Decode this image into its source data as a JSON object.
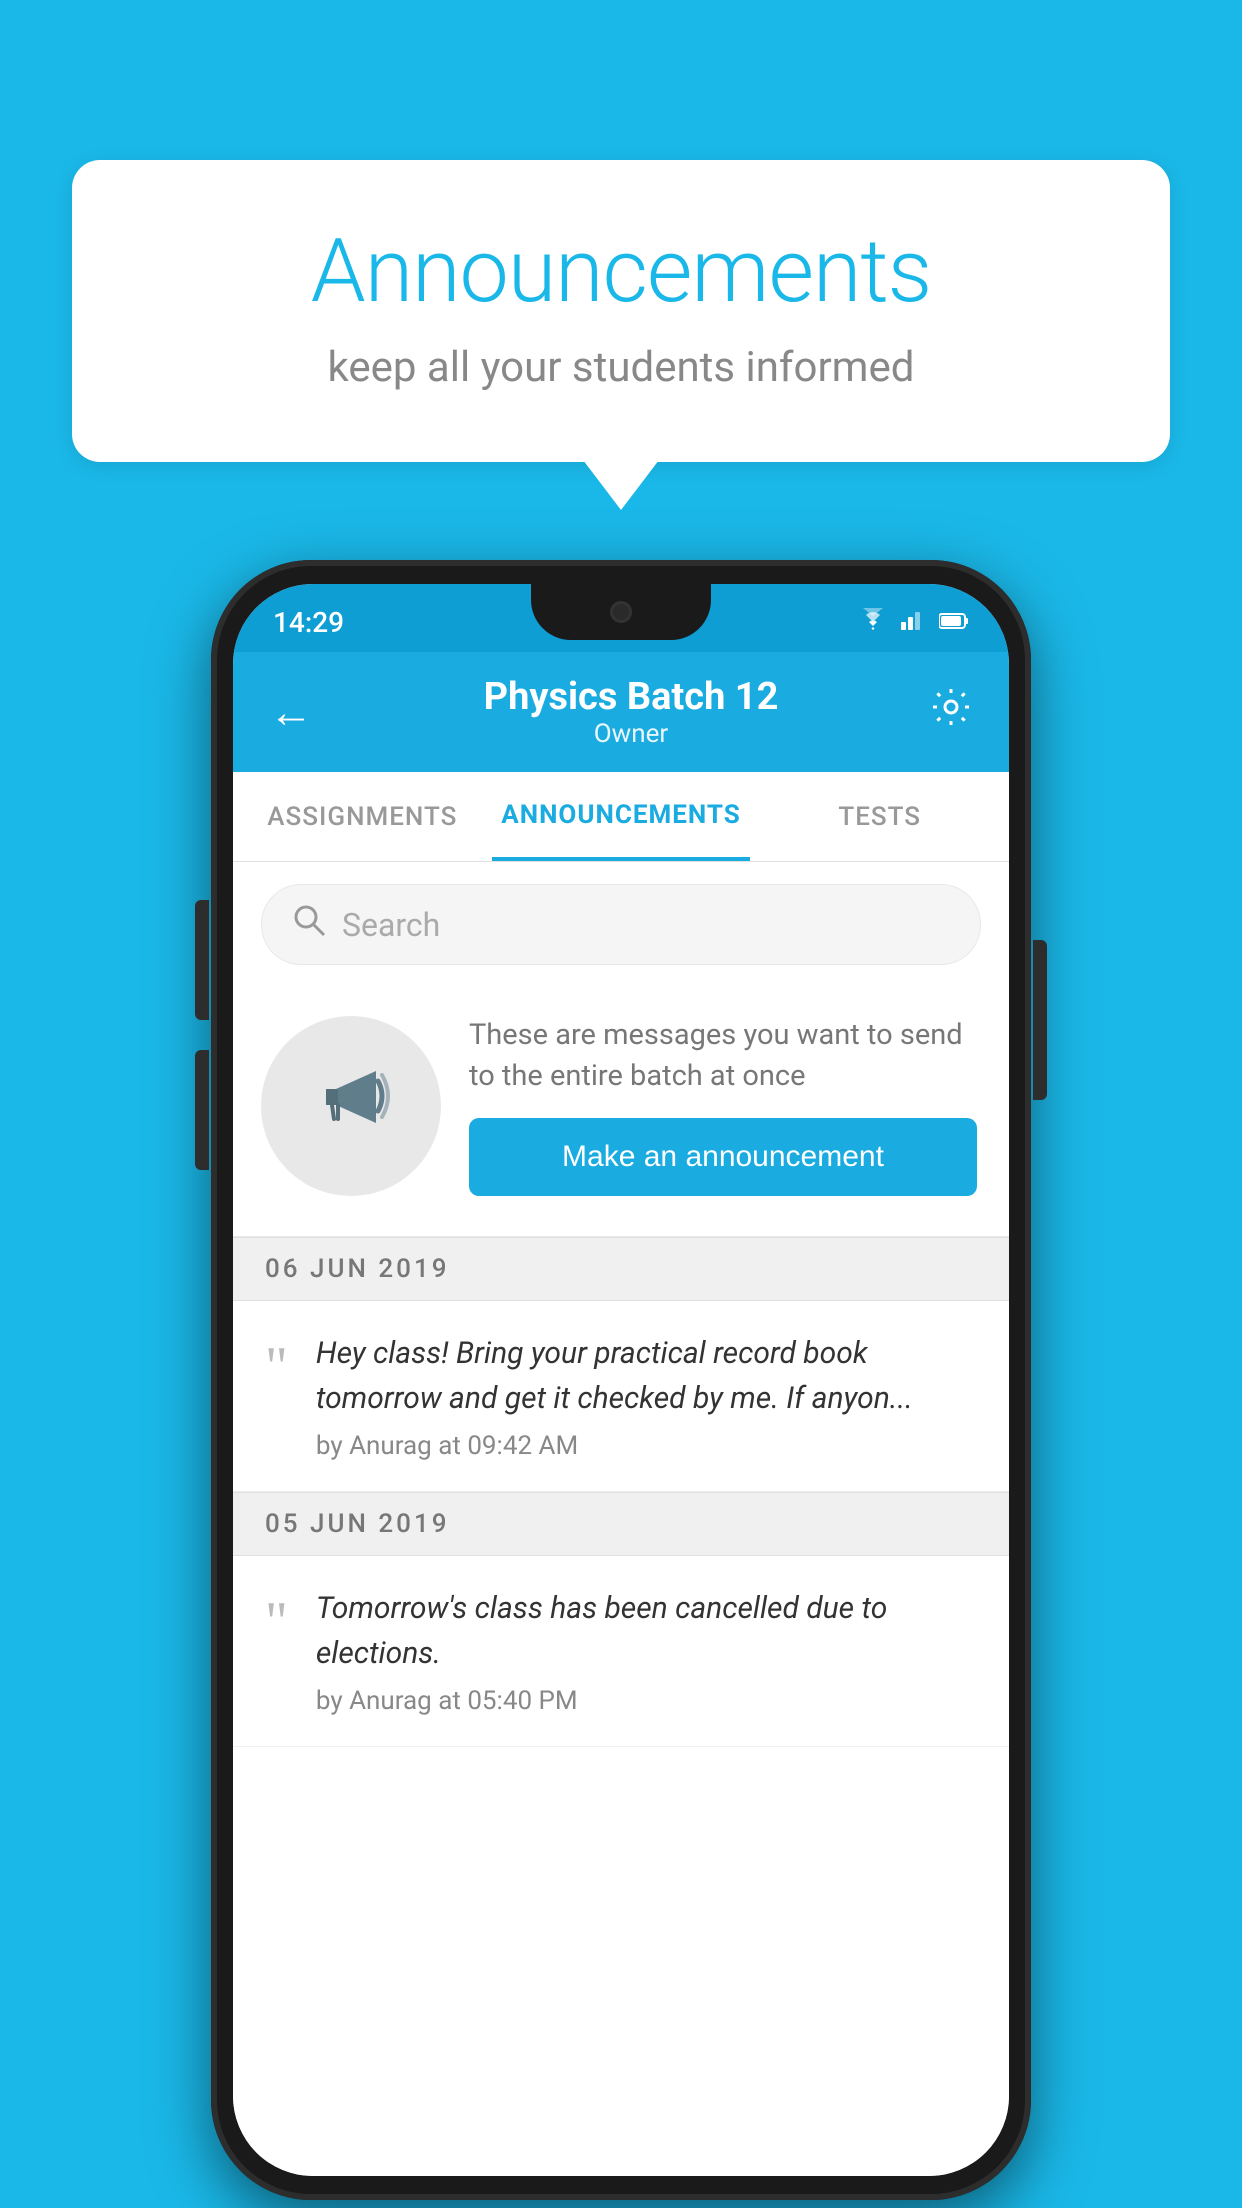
{
  "background_color": "#1ab8e8",
  "speech_bubble": {
    "title": "Announcements",
    "subtitle": "keep all your students informed"
  },
  "phone": {
    "status_bar": {
      "time": "14:29",
      "icons": [
        "wifi",
        "signal",
        "battery"
      ]
    },
    "header": {
      "title": "Physics Batch 12",
      "subtitle": "Owner",
      "back_label": "←",
      "settings_label": "⚙"
    },
    "tabs": [
      {
        "label": "ASSIGNMENTS",
        "active": false
      },
      {
        "label": "ANNOUNCEMENTS",
        "active": true
      },
      {
        "label": "TESTS",
        "active": false
      }
    ],
    "search": {
      "placeholder": "Search"
    },
    "promo_card": {
      "description": "These are messages you want to send to the entire batch at once",
      "button_label": "Make an announcement"
    },
    "announcements": [
      {
        "date": "06  JUN  2019",
        "items": [
          {
            "text": "Hey class! Bring your practical record book tomorrow and get it checked by me. If anyon...",
            "author": "by Anurag at 09:42 AM"
          }
        ]
      },
      {
        "date": "05  JUN  2019",
        "items": [
          {
            "text": "Tomorrow's class has been cancelled due to elections.",
            "author": "by Anurag at 05:40 PM"
          }
        ]
      }
    ]
  }
}
